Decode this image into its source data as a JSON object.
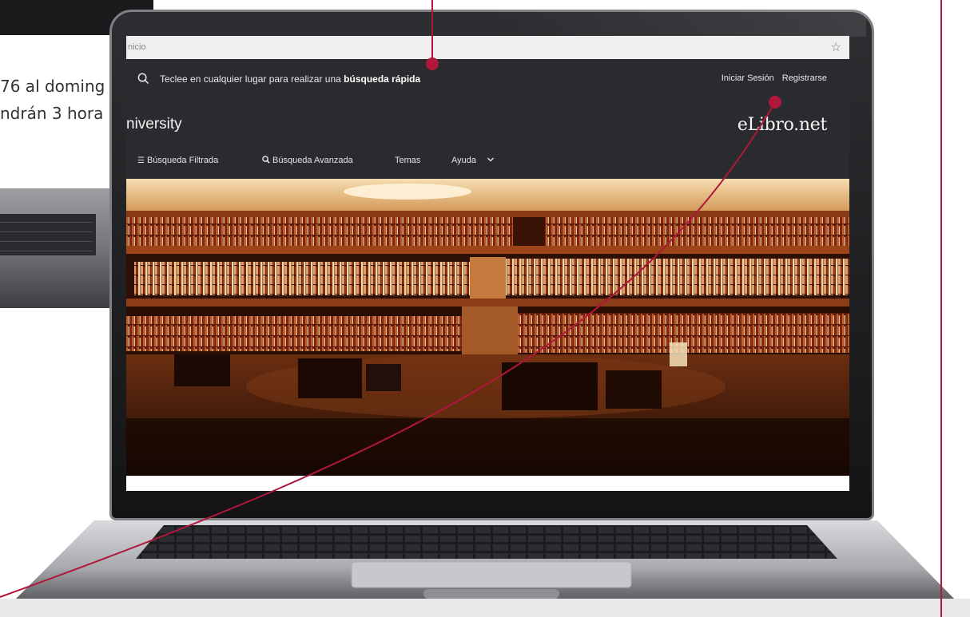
{
  "background_laptop": {
    "text_line_1": "76 al doming",
    "text_line_2": "ndrán 3 hora"
  },
  "browser": {
    "address_text": "nicio",
    "bookmark_icon": "star-icon"
  },
  "header": {
    "search_icon": "search-icon",
    "search_hint_prefix": "Teclee en cualquier lugar para realizar una",
    "search_hint_bold": "búsqueda rápida",
    "login_label": "Iniciar Sesión",
    "register_label": "Registrarse",
    "brand_left": "niversity",
    "brand_right": "eLibro.net"
  },
  "nav": {
    "items": [
      {
        "label": "Búsqueda Filtrada",
        "icon": "filter-icon"
      },
      {
        "label": "Búsqueda Avanzada",
        "icon": "search-icon"
      },
      {
        "label": "Temas"
      },
      {
        "label": "Ayuda",
        "icon": "chevron-down-icon"
      }
    ]
  },
  "hero": {
    "image": "circular-library-bookshelves"
  },
  "colors": {
    "header_bg": "#2a2b2f",
    "callout_line": "#b0173a",
    "hero_wood": "#7a3414"
  }
}
